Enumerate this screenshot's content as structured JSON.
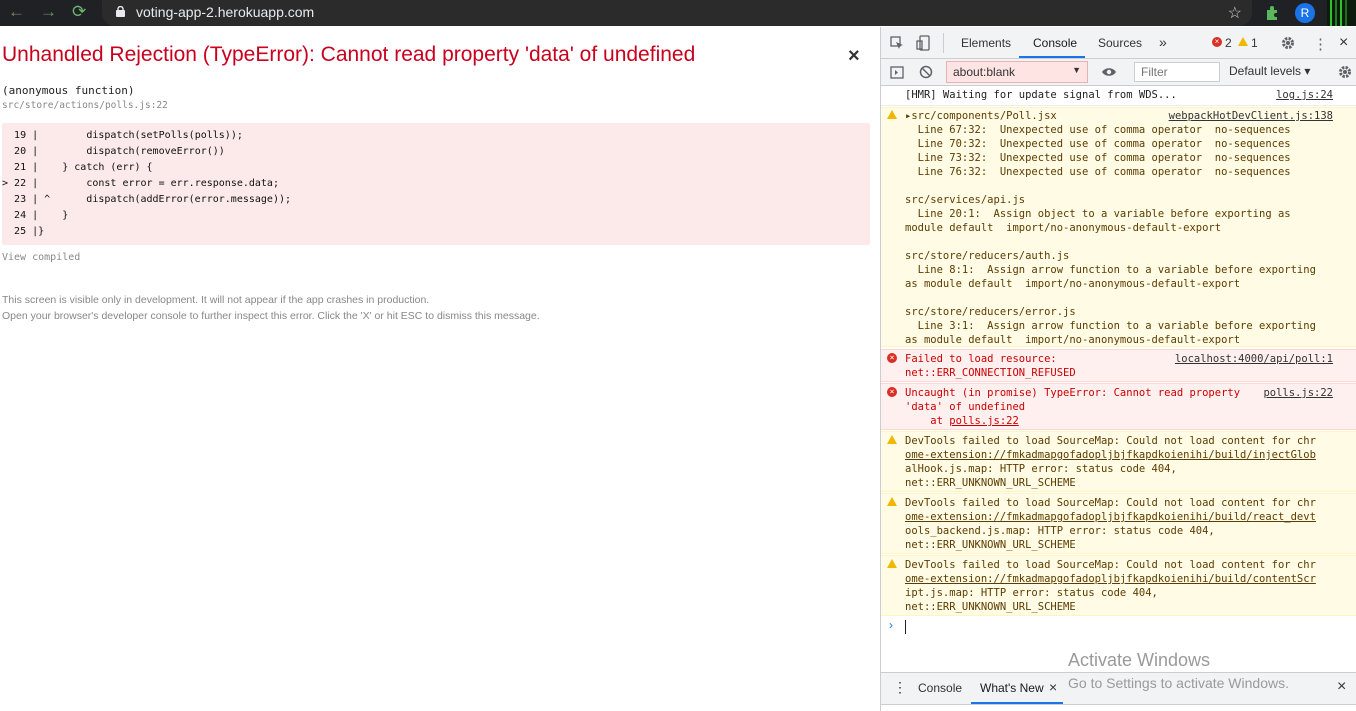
{
  "browser": {
    "url": "voting-app-2.herokuapp.com",
    "avatar_letter": "R",
    "back_glyph": "←",
    "forward_glyph": "→",
    "reload_glyph": "⟳",
    "star_glyph": "☆"
  },
  "overlay": {
    "title": "Unhandled Rejection (TypeError): Cannot read property 'data' of undefined",
    "close_glyph": "×",
    "function_name": "(anonymous function)",
    "function_path": "src/store/actions/polls.js:22",
    "code_lines": [
      {
        "marker": "  ",
        "num": "19",
        "bar": "|",
        "code": "        dispatch(setPolls(polls));"
      },
      {
        "marker": "  ",
        "num": "20",
        "bar": "|",
        "code": "        dispatch(removeError())"
      },
      {
        "marker": "  ",
        "num": "21",
        "bar": "|",
        "code": "    } catch (err) {"
      },
      {
        "marker": "> ",
        "num": "22",
        "bar": "|",
        "code": "        const error = err.response.data;"
      },
      {
        "marker": "  ",
        "num": "23",
        "bar": "| ^",
        "code": "      dispatch(addError(error.message));"
      },
      {
        "marker": "  ",
        "num": "24",
        "bar": "|",
        "code": "    }"
      },
      {
        "marker": "  ",
        "num": "25",
        "bar": "|",
        "code": "}"
      }
    ],
    "view_compiled": "View compiled",
    "note1": "This screen is visible only in development. It will not appear if the app crashes in production.",
    "note2": "Open your browser's developer console to further inspect this error.  Click the 'X' or hit ESC to dismiss this message."
  },
  "devtools": {
    "tabs": [
      "Elements",
      "Console",
      "Sources"
    ],
    "more_tabs": "»",
    "error_count": "2",
    "warning_count": "1",
    "context": "about:blank",
    "filter_placeholder": "Filter",
    "levels": "Default levels ▾",
    "messages": {
      "hmr": {
        "text": "[HMR] Waiting for update signal from WDS...",
        "source": "log.js:24"
      },
      "lint_file1": "▸src/components/Poll.jsx",
      "lint_file1_source": "webpackHotDevClient.js:138",
      "lint_lines1": [
        "  Line 67:32:  Unexpected use of comma operator  no-sequences",
        "  Line 70:32:  Unexpected use of comma operator  no-sequences",
        "  Line 73:32:  Unexpected use of comma operator  no-sequences",
        "  Line 76:32:  Unexpected use of comma operator  no-sequences"
      ],
      "lint_file2": "src/services/api.js",
      "lint_lines2": [
        "  Line 20:1:  Assign object to a variable before exporting as",
        "module default  import/no-anonymous-default-export"
      ],
      "lint_file3": "src/store/reducers/auth.js",
      "lint_lines3": [
        "  Line 8:1:  Assign arrow function to a variable before exporting",
        "as module default  import/no-anonymous-default-export"
      ],
      "lint_file4": "src/store/reducers/error.js",
      "lint_lines4": [
        "  Line 3:1:  Assign arrow function to a variable before exporting",
        "as module default  import/no-anonymous-default-export"
      ],
      "err1_line1": "Failed to load resource:",
      "err1_line2": "net::ERR_CONNECTION_REFUSED",
      "err1_source": "localhost:4000/api/poll:1",
      "err2_line1": "Uncaught (in promise) TypeError: Cannot read property",
      "err2_line2": "'data' of undefined",
      "err2_line3_prefix": "    at ",
      "err2_line3_link": "polls.js:22",
      "err2_source": "polls.js:22",
      "warn_a": [
        "DevTools failed to load SourceMap: Could not load content for chr",
        "ome-extension://fmkadmapgofadopljbjfkapdkoienihi/build/injectGlob",
        "alHook.js.map: HTTP error: status code 404,",
        "net::ERR_UNKNOWN_URL_SCHEME"
      ],
      "warn_b": [
        "DevTools failed to load SourceMap: Could not load content for chr",
        "ome-extension://fmkadmapgofadopljbjfkapdkoienihi/build/react_devt",
        "ools_backend.js.map: HTTP error: status code 404,",
        "net::ERR_UNKNOWN_URL_SCHEME"
      ],
      "warn_c": [
        "DevTools failed to load SourceMap: Could not load content for chr",
        "ome-extension://fmkadmapgofadopljbjfkapdkoienihi/build/contentScr",
        "ipt.js.map: HTTP error: status code 404,",
        "net::ERR_UNKNOWN_URL_SCHEME"
      ]
    },
    "prompt": "›",
    "drawer_tabs": [
      "Console",
      "What's New"
    ],
    "drawer_close": "×",
    "drawer_menu": "⋮"
  },
  "watermark": {
    "line1": "Activate Windows",
    "line2": "Go to Settings to activate Windows."
  },
  "colors": {
    "error_red": "#c9001d",
    "devtools_blue": "#1a73e8"
  }
}
